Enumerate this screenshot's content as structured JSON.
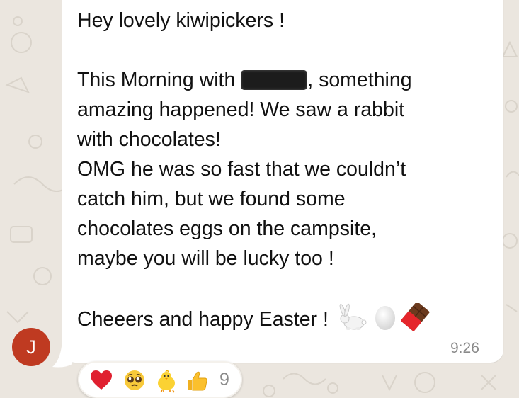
{
  "message": {
    "line1": "Hey lovely kiwipickers !",
    "line2_before": "This Morning with ",
    "line2_after": ", something",
    "line3": "amazing happened! We saw a rabbit",
    "line4": "with chocolates!",
    "line5": "OMG he was so fast that we couldn’t",
    "line6": "catch him, but we found some",
    "line7": "chocolates eggs on the campsite,",
    "line8": "maybe you will be lucky too !",
    "line9": "Cheeers and happy Easter ! ",
    "emojis": [
      "rabbit-icon",
      "egg-icon",
      "chocolate-bar-icon"
    ]
  },
  "timestamp": "9:26",
  "sender": {
    "initial": "J",
    "avatar_color": "#bf3a21"
  },
  "reactions": {
    "icons": [
      "red-heart-icon",
      "pleading-face-icon",
      "baby-chick-icon",
      "thumbs-up-icon"
    ],
    "count": "9"
  }
}
